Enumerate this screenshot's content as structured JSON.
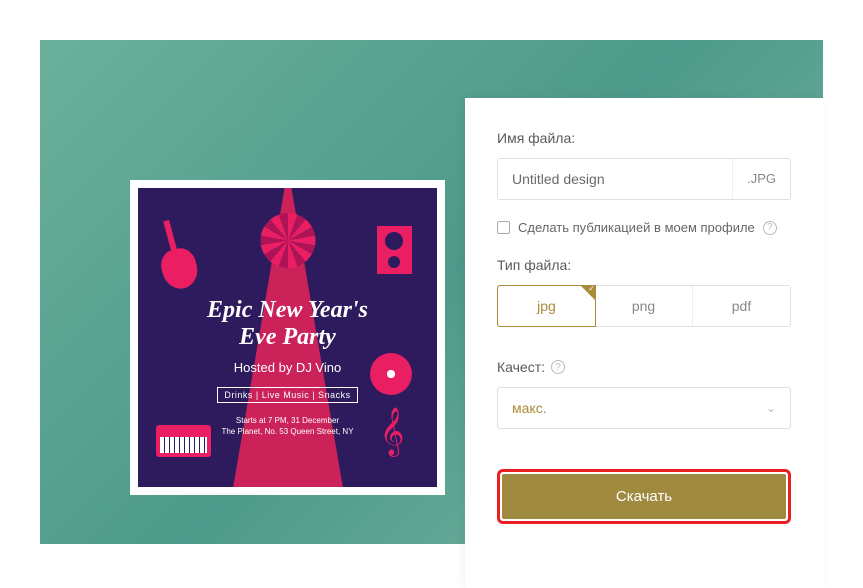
{
  "poster": {
    "title_line1": "Epic New Year's",
    "title_line2": "Eve Party",
    "subtitle": "Hosted by DJ Vino",
    "tags": "Drinks | Live Music | Snacks",
    "info_line1": "Starts at 7 PM, 31 December",
    "info_line2": "The Planet, No. 53 Queen Street, NY"
  },
  "panel": {
    "filename_label": "Имя файла:",
    "filename_value": "Untitled design",
    "filename_ext": ".JPG",
    "checkbox_label": "Сделать публикацией в моем профиле",
    "filetype_label": "Тип файла:",
    "types": {
      "jpg": "jpg",
      "png": "png",
      "pdf": "pdf"
    },
    "quality_label": "Качест:",
    "quality_value": "макс.",
    "download_label": "Скачать"
  }
}
